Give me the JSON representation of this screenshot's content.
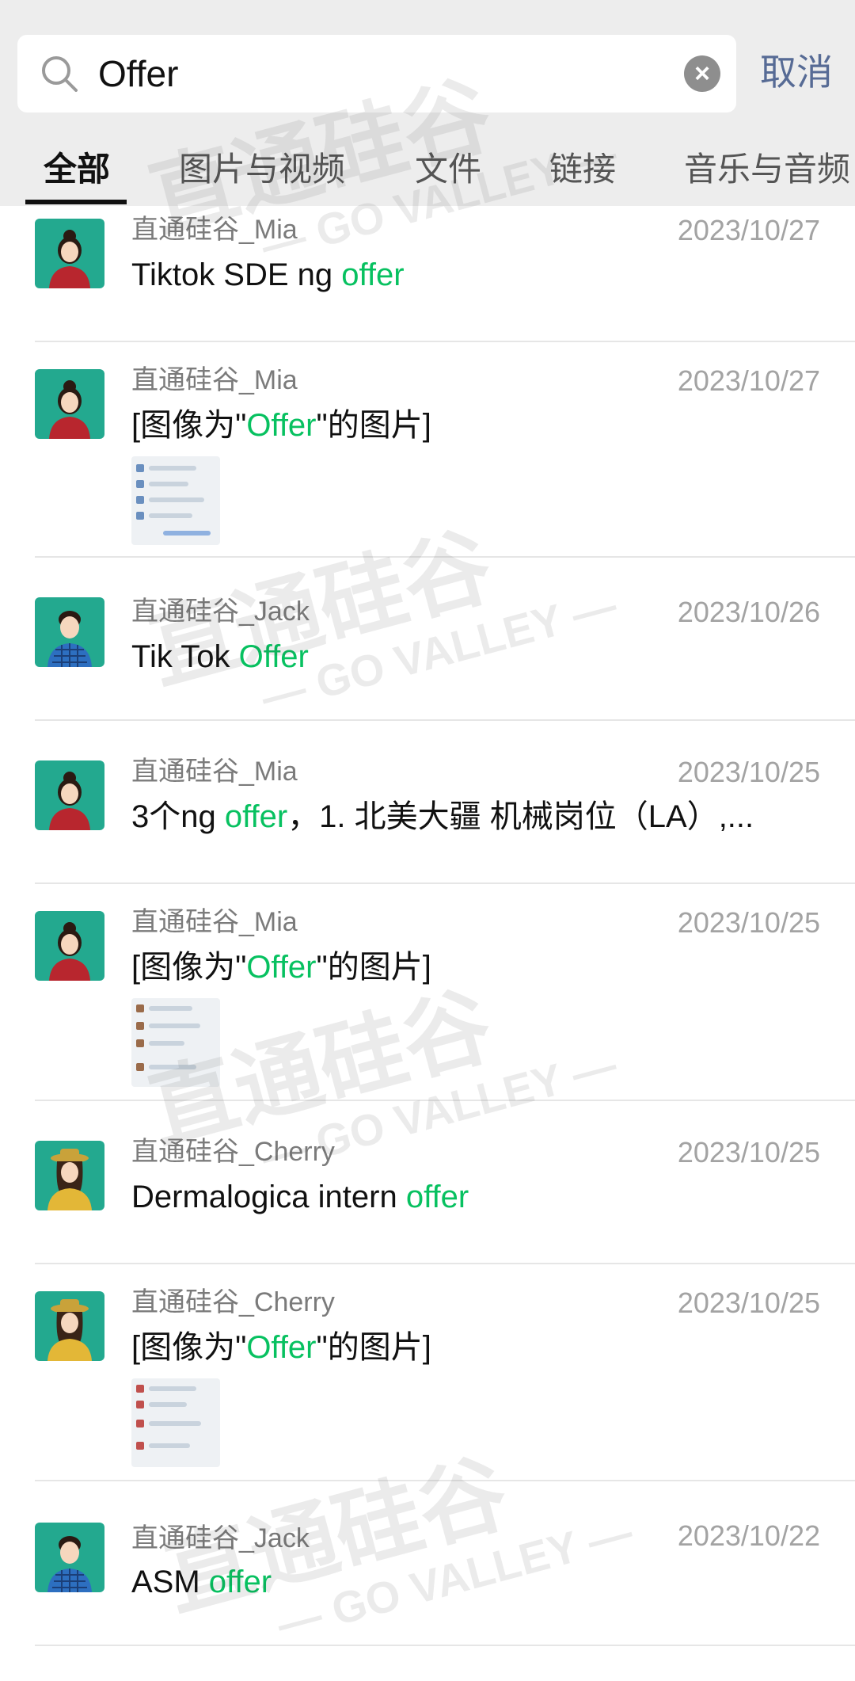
{
  "search": {
    "value": "Offer"
  },
  "cancel_label": "取消",
  "tabs": [
    "全部",
    "图片与视频",
    "文件",
    "链接",
    "音乐与音频"
  ],
  "results": [
    {
      "sender": "直通硅谷_Mia",
      "date": "2023/10/27",
      "pre": "Tiktok SDE ng ",
      "hl": "offer",
      "post": ""
    },
    {
      "sender": "直通硅谷_Mia",
      "date": "2023/10/27",
      "pre": "[图像为\"",
      "hl": "Offer",
      "post": "\"的图片]"
    },
    {
      "sender": "直通硅谷_Jack",
      "date": "2023/10/26",
      "pre": "Tik Tok ",
      "hl": "Offer",
      "post": ""
    },
    {
      "sender": "直通硅谷_Mia",
      "date": "2023/10/25",
      "pre": "3个ng ",
      "hl": "offer",
      "post": "，1. 北美大疆 机械岗位（LA）,..."
    },
    {
      "sender": "直通硅谷_Mia",
      "date": "2023/10/25",
      "pre": "[图像为\"",
      "hl": "Offer",
      "post": "\"的图片]"
    },
    {
      "sender": "直通硅谷_Cherry",
      "date": "2023/10/25",
      "pre": "Dermalogica intern ",
      "hl": "offer",
      "post": ""
    },
    {
      "sender": "直通硅谷_Cherry",
      "date": "2023/10/25",
      "pre": "[图像为\"",
      "hl": "Offer",
      "post": "\"的图片]"
    },
    {
      "sender": "直通硅谷_Jack",
      "date": "2023/10/22",
      "pre": "ASM ",
      "hl": "offer",
      "post": ""
    }
  ],
  "watermark": {
    "brand": "直通硅谷",
    "sub": "— GO VALLEY —"
  },
  "colors": {
    "highlight": "#07c160",
    "link": "#576b95"
  }
}
